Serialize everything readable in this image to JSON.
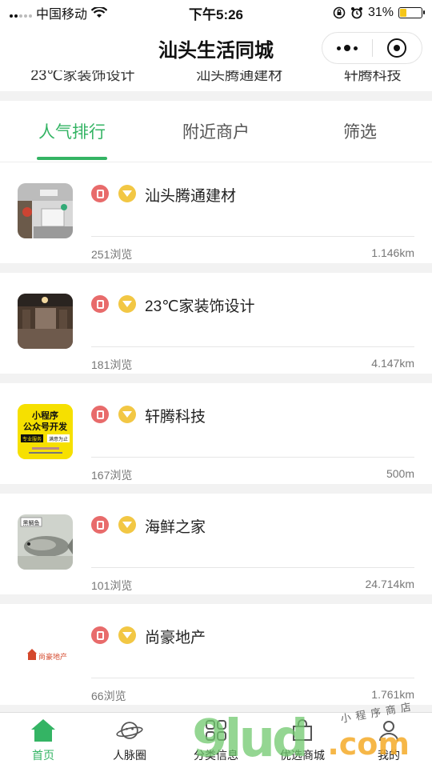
{
  "status_bar": {
    "carrier": "中国移动",
    "time": "下午5:26",
    "battery_percent": "31%",
    "battery_level": 0.31
  },
  "nav": {
    "title": "汕头生活同城"
  },
  "carousel_remnant": [
    "23℃家装饰设计",
    "汕头腾通建材",
    "轩腾科技"
  ],
  "tabs": [
    {
      "label": "人气排行",
      "active": true
    },
    {
      "label": "附近商户",
      "active": false
    },
    {
      "label": "筛选",
      "active": false
    }
  ],
  "stores": [
    {
      "name": "汕头腾通建材",
      "views": "251浏览",
      "distance": "1.146km"
    },
    {
      "name": "23℃家装饰设计",
      "views": "181浏览",
      "distance": "4.147km"
    },
    {
      "name": "轩腾科技",
      "views": "167浏览",
      "distance": "500m"
    },
    {
      "name": "海鲜之家",
      "views": "101浏览",
      "distance": "24.714km"
    },
    {
      "name": "尚豪地产",
      "views": "66浏览",
      "distance": "1.761km"
    }
  ],
  "thumb_text": {
    "ad_line1": "小程序",
    "ad_line2": "公众号开发",
    "ad_tag1": "专业服务",
    "ad_tag2": "满意为止",
    "fish_label": "黑鲷鱼",
    "logo_text": "尚豪地产"
  },
  "tab_bar": [
    {
      "label": "首页",
      "icon": "home-icon",
      "active": true
    },
    {
      "label": "人脉圈",
      "icon": "planet-icon",
      "active": false
    },
    {
      "label": "分类信息",
      "icon": "grid-icon",
      "active": false
    },
    {
      "label": "优选商城",
      "icon": "shop-icon",
      "active": false
    },
    {
      "label": "我的",
      "icon": "user-icon",
      "active": false
    }
  ],
  "watermark": {
    "main": "9lud",
    "suffix": ".com",
    "handwriting": "小程序商店"
  },
  "colors": {
    "accent": "#34b464",
    "badge_red": "#e86b6b",
    "badge_gold": "#f2c744"
  }
}
